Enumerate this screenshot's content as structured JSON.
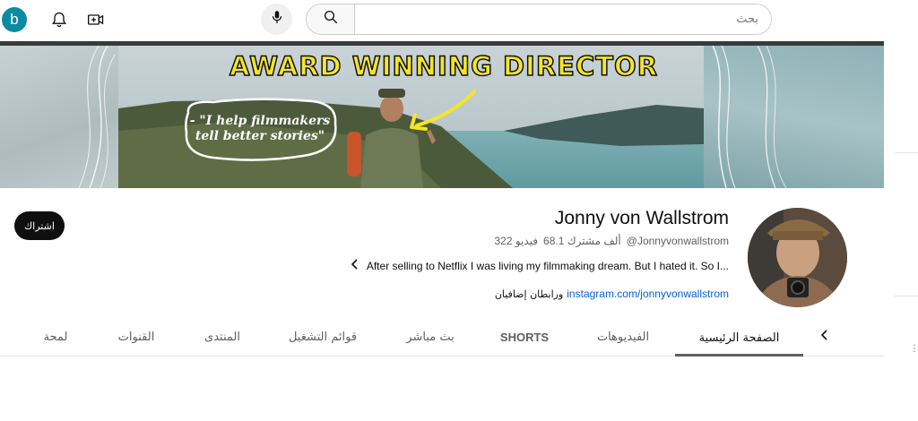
{
  "header": {
    "account_initial": "b",
    "search_placeholder": "بحث",
    "icons": [
      "notifications-icon",
      "create-video-icon",
      "mic-icon",
      "search-icon"
    ]
  },
  "banner": {
    "title": "AWARD WINNING DIRECTOR",
    "speech_line1": "- \"I help filmmakers",
    "speech_line2": "tell better stories\""
  },
  "channel": {
    "name": "Jonny von Wallstrom",
    "handle": "@Jonnyvonwallstrom",
    "subscribers": "68.1 ألف مشترك",
    "videos": "322 فيديو",
    "description": "After selling to Netflix I was living my filmmaking dream. But I hated it. So I...",
    "link": "instagram.com/jonnyvonwallstrom",
    "more_links": "ورابطان إضافيان",
    "subscribe_label": "اشتراك"
  },
  "tabs": [
    {
      "label": "الصفحة الرئيسية",
      "active": true
    },
    {
      "label": "الفيديوهات",
      "active": false
    },
    {
      "label": "SHORTS",
      "active": false
    },
    {
      "label": "بث مباشر",
      "active": false
    },
    {
      "label": "قوائم التشغيل",
      "active": false
    },
    {
      "label": "المنتدى",
      "active": false
    },
    {
      "label": "القنوات",
      "active": false
    },
    {
      "label": "لمحة",
      "active": false
    }
  ],
  "colors": {
    "accent_link": "#065fd4",
    "subscribe_bg": "#0f0f0f",
    "avatar_bg": "#0b8aa5",
    "banner_title": "#f5e526"
  }
}
